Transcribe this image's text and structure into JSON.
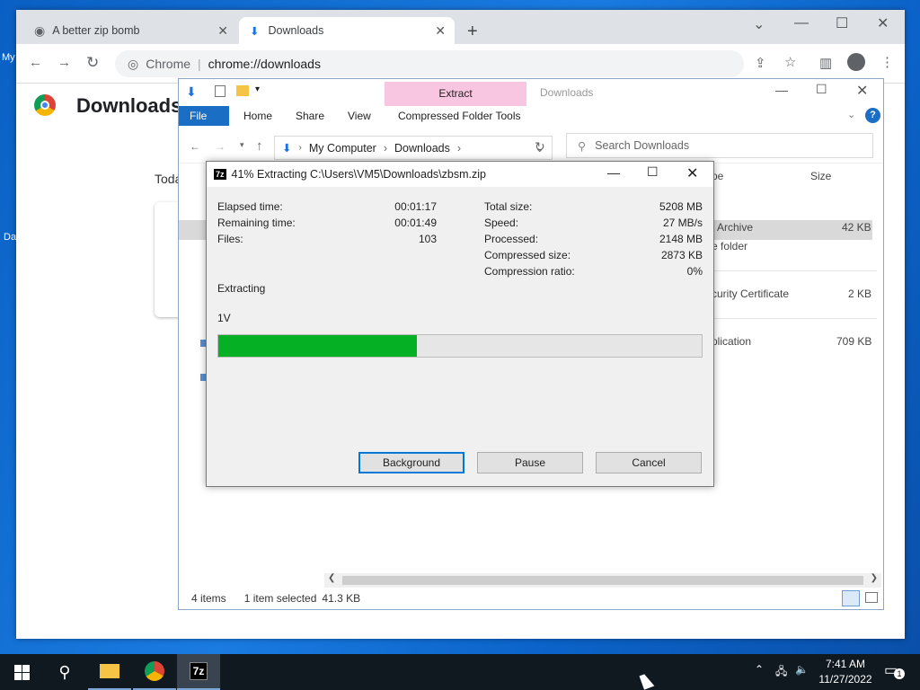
{
  "desktop": {
    "icon_labels": [
      "My",
      "Da"
    ]
  },
  "browser": {
    "tabs": [
      {
        "title": "A better zip bomb",
        "active": false
      },
      {
        "title": "Downloads",
        "active": true
      }
    ],
    "new_tab": "+",
    "omnibox": {
      "site": "Chrome",
      "url": "chrome://downloads"
    },
    "page_title": "Downloads",
    "today_label": "Toda"
  },
  "explorer": {
    "title": "Downloads",
    "ribbon": {
      "file": "File",
      "home": "Home",
      "share": "Share",
      "view": "View",
      "extract": "Extract",
      "compressed_tools": "Compressed Folder Tools"
    },
    "breadcrumb": [
      "My Computer",
      "Downloads"
    ],
    "search_placeholder": "Search Downloads",
    "columns": {
      "type": "pe",
      "size": "Size"
    },
    "rows": [
      {
        "type": "Archive",
        "size": "42 KB"
      },
      {
        "type": "e folder",
        "size": ""
      },
      {
        "type": "curity Certificate",
        "size": "2 KB"
      },
      {
        "type": "plication",
        "size": "709 KB"
      }
    ],
    "status": {
      "items": "4 items",
      "selected": "1 item selected",
      "size": "41.3 KB"
    }
  },
  "zip_dialog": {
    "icon_text": "7z",
    "title": "41% Extracting C:\\Users\\VM5\\Downloads\\zbsm.zip",
    "left_stats": [
      {
        "label": "Elapsed time:",
        "value": "00:01:17"
      },
      {
        "label": "Remaining time:",
        "value": "00:01:49"
      },
      {
        "label": "Files:",
        "value": "103"
      }
    ],
    "right_stats": [
      {
        "label": "Total size:",
        "value": "5208 MB"
      },
      {
        "label": "Speed:",
        "value": "27 MB/s"
      },
      {
        "label": "Processed:",
        "value": "2148 MB"
      },
      {
        "label": "Compressed size:",
        "value": "2873 KB"
      },
      {
        "label": "Compression ratio:",
        "value": "0%"
      }
    ],
    "status_text": "Extracting",
    "current_file": "1V",
    "progress": 0.41,
    "progress_color": "#06b025",
    "buttons": {
      "background": "Background",
      "pause": "Pause",
      "cancel": "Cancel"
    }
  },
  "taskbar": {
    "time": "7:41 AM",
    "date": "11/27/2022",
    "notification_count": "1",
    "active_app": "7z"
  }
}
